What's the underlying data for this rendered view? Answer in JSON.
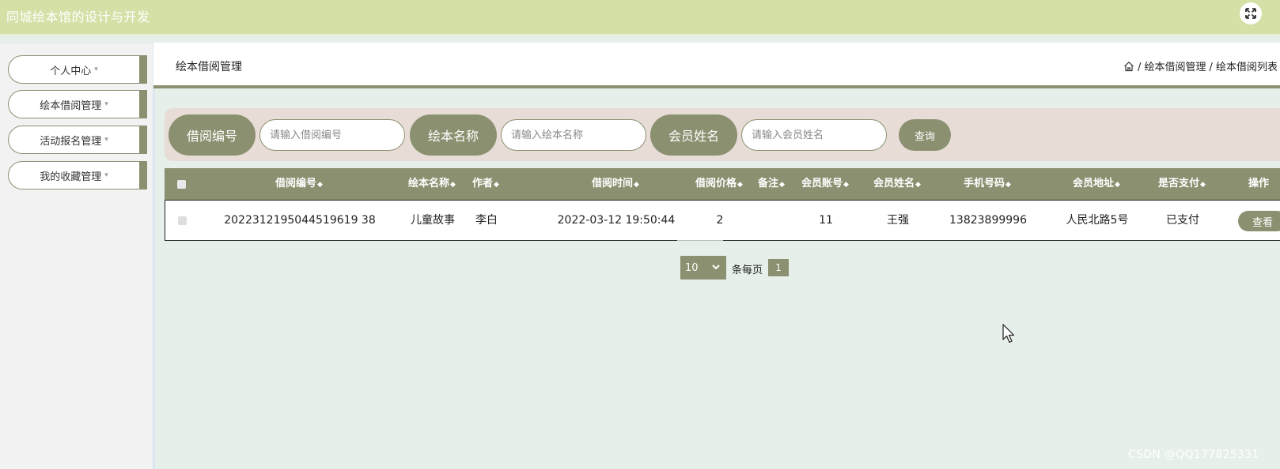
{
  "app": {
    "title": "同城绘本馆的设计与开发"
  },
  "sidebar": {
    "items": [
      {
        "label": "个人中心"
      },
      {
        "label": "绘本借阅管理"
      },
      {
        "label": "活动报名管理"
      },
      {
        "label": "我的收藏管理"
      }
    ]
  },
  "header": {
    "page_title": "绘本借阅管理",
    "breadcrumb": [
      "/ 绘本借阅管理",
      "/ 绘本借阅列表"
    ]
  },
  "search": {
    "fields": [
      {
        "label": "借阅编号",
        "placeholder": "请输入借阅编号"
      },
      {
        "label": "绘本名称",
        "placeholder": "请输入绘本名称"
      },
      {
        "label": "会员姓名",
        "placeholder": "请输入会员姓名"
      }
    ],
    "button": "查询"
  },
  "table": {
    "sort_icon": "◆",
    "columns": [
      "借阅编号",
      "绘本名称",
      "作者",
      "借阅时间",
      "借阅价格",
      "备注",
      "会员账号",
      "会员姓名",
      "手机号码",
      "会员地址",
      "是否支付",
      "操作"
    ],
    "rows": [
      {
        "cells": [
          "2022312195044519619 38",
          "儿童故事",
          "李白",
          "2022-03-12 19:50:44",
          "2",
          "",
          "11",
          "王强",
          "13823899996",
          "人民北路5号",
          "已支付"
        ],
        "action": "查看"
      }
    ]
  },
  "pagination": {
    "page_size": "10",
    "per_page_label": "条每页",
    "current_page": "1"
  },
  "watermark": "CSDN @QQ177825331",
  "colors": {
    "accent": "#8b9070",
    "topbar": "#d3e0a6",
    "search_bg": "#e8dcd7",
    "page_bg": "#e6efe9"
  }
}
